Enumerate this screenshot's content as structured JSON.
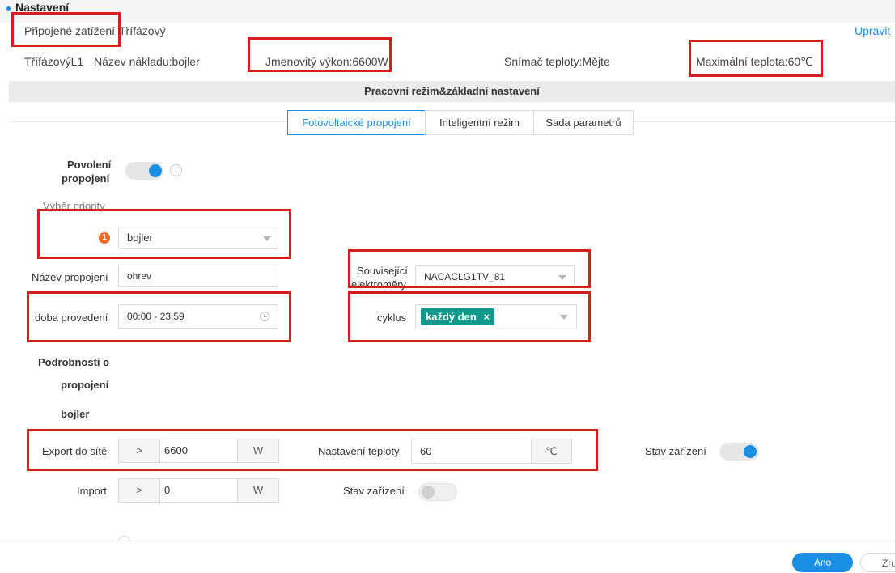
{
  "header": {
    "title": "Nastavení",
    "edit_link": "Upravit"
  },
  "load": {
    "connected_label": "Připojené zatížení :",
    "connected_value": "Třífázový",
    "phase": "TřífázovýL1",
    "name": "Název nákladu:bojler",
    "rated_power": "Jmenovitý výkon:6600W",
    "temp_sensor": "Snímač teploty:Mějte",
    "max_temp": "Maximální teplota:60℃"
  },
  "section": {
    "title": "Pracovní režim&základní nastavení"
  },
  "tabs": [
    {
      "label": "Fotovoltaické propojení",
      "active": true
    },
    {
      "label": "Inteligentní režim",
      "active": false
    },
    {
      "label": "Sada parametrů",
      "active": false
    }
  ],
  "form": {
    "enable_label_1": "Povolení",
    "enable_label_2": "propojení",
    "enable_on": true,
    "priority_label": "Výběr priority",
    "priority_badge": "1",
    "priority_value": "bojler",
    "link_name_label": "Název propojení",
    "link_name_value": "ohrev",
    "meters_label_1": "Související",
    "meters_label_2": "elektroměry",
    "meters_value": "NACACLG1TV_81",
    "time_label": "doba provedení",
    "time_value": "00:00 - 23:59",
    "cycle_label": "cyklus",
    "cycle_tag": "každý den",
    "cycle_tag_close": "×"
  },
  "details": {
    "title_1": "Podrobnosti o",
    "title_2": "propojení",
    "device": "bojler",
    "export_label": "Export do sítě",
    "export_op": ">",
    "export_value": "6600",
    "export_unit": "W",
    "temp_label": "Nastavení teploty",
    "temp_value": "60",
    "temp_unit": "℃",
    "state_label": "Stav zařízení",
    "state_on": true,
    "import_label": "Import",
    "import_op": ">",
    "import_value": "0",
    "import_unit": "W",
    "state2_label": "Stav zařízení",
    "state2_on": false
  },
  "footer": {
    "ok": "Ano",
    "cancel": "Zru"
  },
  "colors": {
    "accent": "#1a8fe3",
    "highlight": "#d71e1e",
    "tag": "#0f9a8c",
    "badge": "#f06a1d"
  }
}
